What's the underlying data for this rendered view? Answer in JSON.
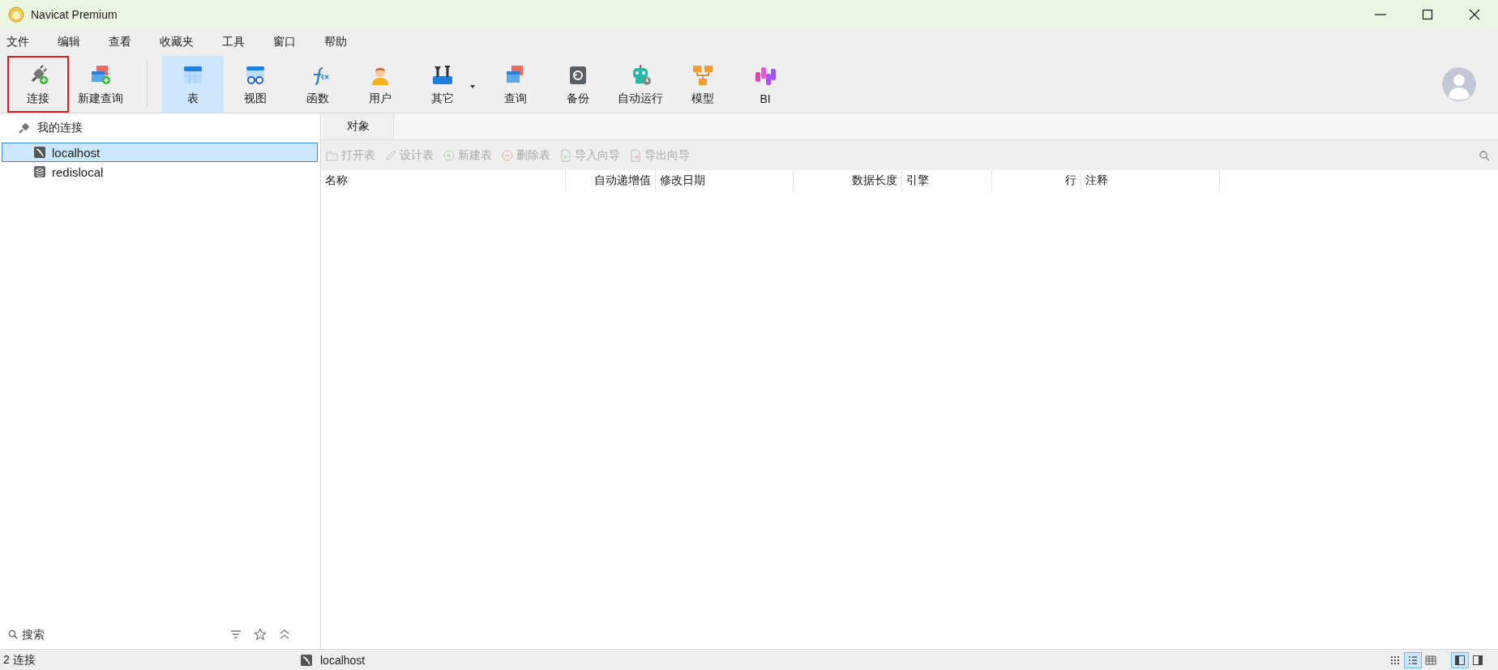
{
  "window": {
    "title": "Navicat Premium"
  },
  "menu": [
    "文件",
    "编辑",
    "查看",
    "收藏夹",
    "工具",
    "窗口",
    "帮助"
  ],
  "toolbar": [
    {
      "label": "连接",
      "selected": false,
      "outlined": true,
      "separator_before": false,
      "dropdown": false
    },
    {
      "label": "新建查询",
      "selected": false,
      "outlined": false,
      "separator_before": false,
      "dropdown": false
    },
    {
      "label": "表",
      "selected": true,
      "outlined": false,
      "separator_before": true,
      "dropdown": false
    },
    {
      "label": "视图",
      "selected": false,
      "outlined": false,
      "separator_before": false,
      "dropdown": false
    },
    {
      "label": "函数",
      "selected": false,
      "outlined": false,
      "separator_before": false,
      "dropdown": false
    },
    {
      "label": "用户",
      "selected": false,
      "outlined": false,
      "separator_before": false,
      "dropdown": false
    },
    {
      "label": "其它",
      "selected": false,
      "outlined": false,
      "separator_before": false,
      "dropdown": true
    },
    {
      "label": "查询",
      "selected": false,
      "outlined": false,
      "separator_before": false,
      "dropdown": false
    },
    {
      "label": "备份",
      "selected": false,
      "outlined": false,
      "separator_before": false,
      "dropdown": false
    },
    {
      "label": "自动运行",
      "selected": false,
      "outlined": false,
      "separator_before": false,
      "dropdown": false
    },
    {
      "label": "模型",
      "selected": false,
      "outlined": false,
      "separator_before": false,
      "dropdown": false
    },
    {
      "label": "BI",
      "selected": false,
      "outlined": false,
      "separator_before": false,
      "dropdown": false
    }
  ],
  "sidebar": {
    "header": "我的连接",
    "connections": [
      {
        "name": "localhost",
        "kind": "mysql",
        "selected": true
      },
      {
        "name": "redislocal",
        "kind": "redis",
        "selected": false
      }
    ],
    "search": {
      "placeholder": "搜索"
    }
  },
  "tabs": [
    {
      "label": "对象",
      "selected": true
    }
  ],
  "object_toolbar": [
    {
      "label": "打开表",
      "disabled": true
    },
    {
      "label": "设计表",
      "disabled": true
    },
    {
      "label": "新建表",
      "disabled": true
    },
    {
      "label": "删除表",
      "disabled": true
    },
    {
      "label": "导入向导",
      "disabled": true
    },
    {
      "label": "导出向导",
      "disabled": true
    }
  ],
  "table": {
    "columns": [
      {
        "label": "名称",
        "kind": "text"
      },
      {
        "label": "自动递增值",
        "kind": "number"
      },
      {
        "label": "修改日期",
        "kind": "text"
      },
      {
        "label": "数据长度",
        "kind": "number"
      },
      {
        "label": "引擎",
        "kind": "text"
      },
      {
        "label": "行",
        "kind": "number"
      },
      {
        "label": "注释",
        "kind": "text"
      }
    ]
  },
  "status_bar": {
    "count": "2 连接",
    "connection": "localhost",
    "views": [
      {
        "selected": false
      },
      {
        "selected": true
      },
      {
        "selected": false
      }
    ],
    "panes": [
      {
        "selected": true
      },
      {
        "selected": false
      }
    ]
  }
}
